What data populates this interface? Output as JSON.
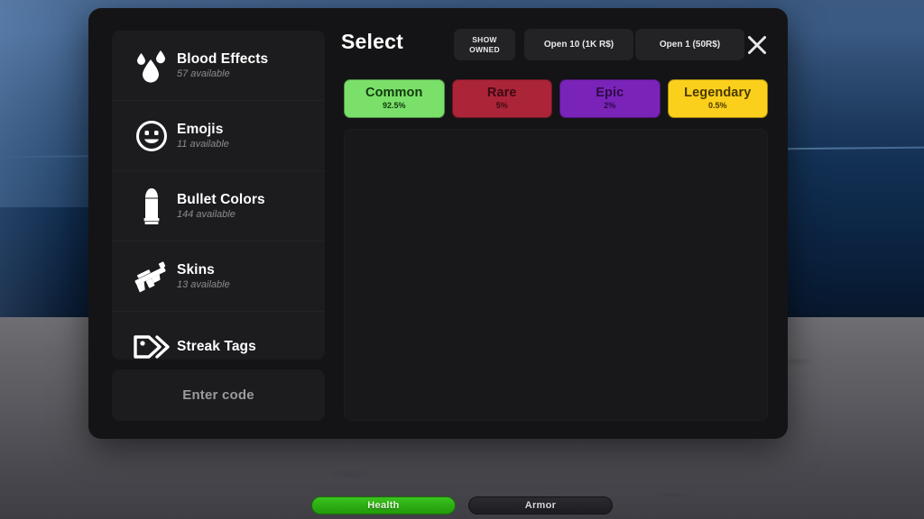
{
  "modal": {
    "title": "Select",
    "header_buttons": [
      {
        "id": "show-owned",
        "label_line1": "SHOW",
        "label_line2": "OWNED"
      },
      {
        "id": "open-ten",
        "label": "Open 10 (1K R$)"
      },
      {
        "id": "open-one",
        "label": "Open 1 (50R$)"
      }
    ],
    "close_icon": "close-icon"
  },
  "sidebar": {
    "items": [
      {
        "icon": "blood-drop-icon",
        "title": "Blood Effects",
        "subtitle": "57 available"
      },
      {
        "icon": "smiley-face-icon",
        "title": "Emojis",
        "subtitle": "11 available"
      },
      {
        "icon": "bullet-icon",
        "title": "Bullet Colors",
        "subtitle": "144 available"
      },
      {
        "icon": "rifle-icon",
        "title": "Skins",
        "subtitle": "13 available"
      },
      {
        "icon": "tag-icon",
        "title": "Streak Tags",
        "subtitle": ""
      }
    ],
    "enter_code_label": "Enter code"
  },
  "rarity_tabs": [
    {
      "name": "Common",
      "percent": "92.5%",
      "bg": "#7ae06a",
      "text": "#123a0c"
    },
    {
      "name": "Rare",
      "percent": "5%",
      "bg": "#ab2437",
      "text": "#3d0a12"
    },
    {
      "name": "Epic",
      "percent": "2%",
      "bg": "#7a23b8",
      "text": "#2d0a46"
    },
    {
      "name": "Legendary",
      "percent": "0.5%",
      "bg": "#fbd01c",
      "text": "#4a3a00"
    }
  ],
  "item_grid": {
    "items": []
  },
  "hud": {
    "health_label": "Health",
    "armor_label": "Armor",
    "health_color": "#2faf15",
    "armor_color": "#232328"
  }
}
